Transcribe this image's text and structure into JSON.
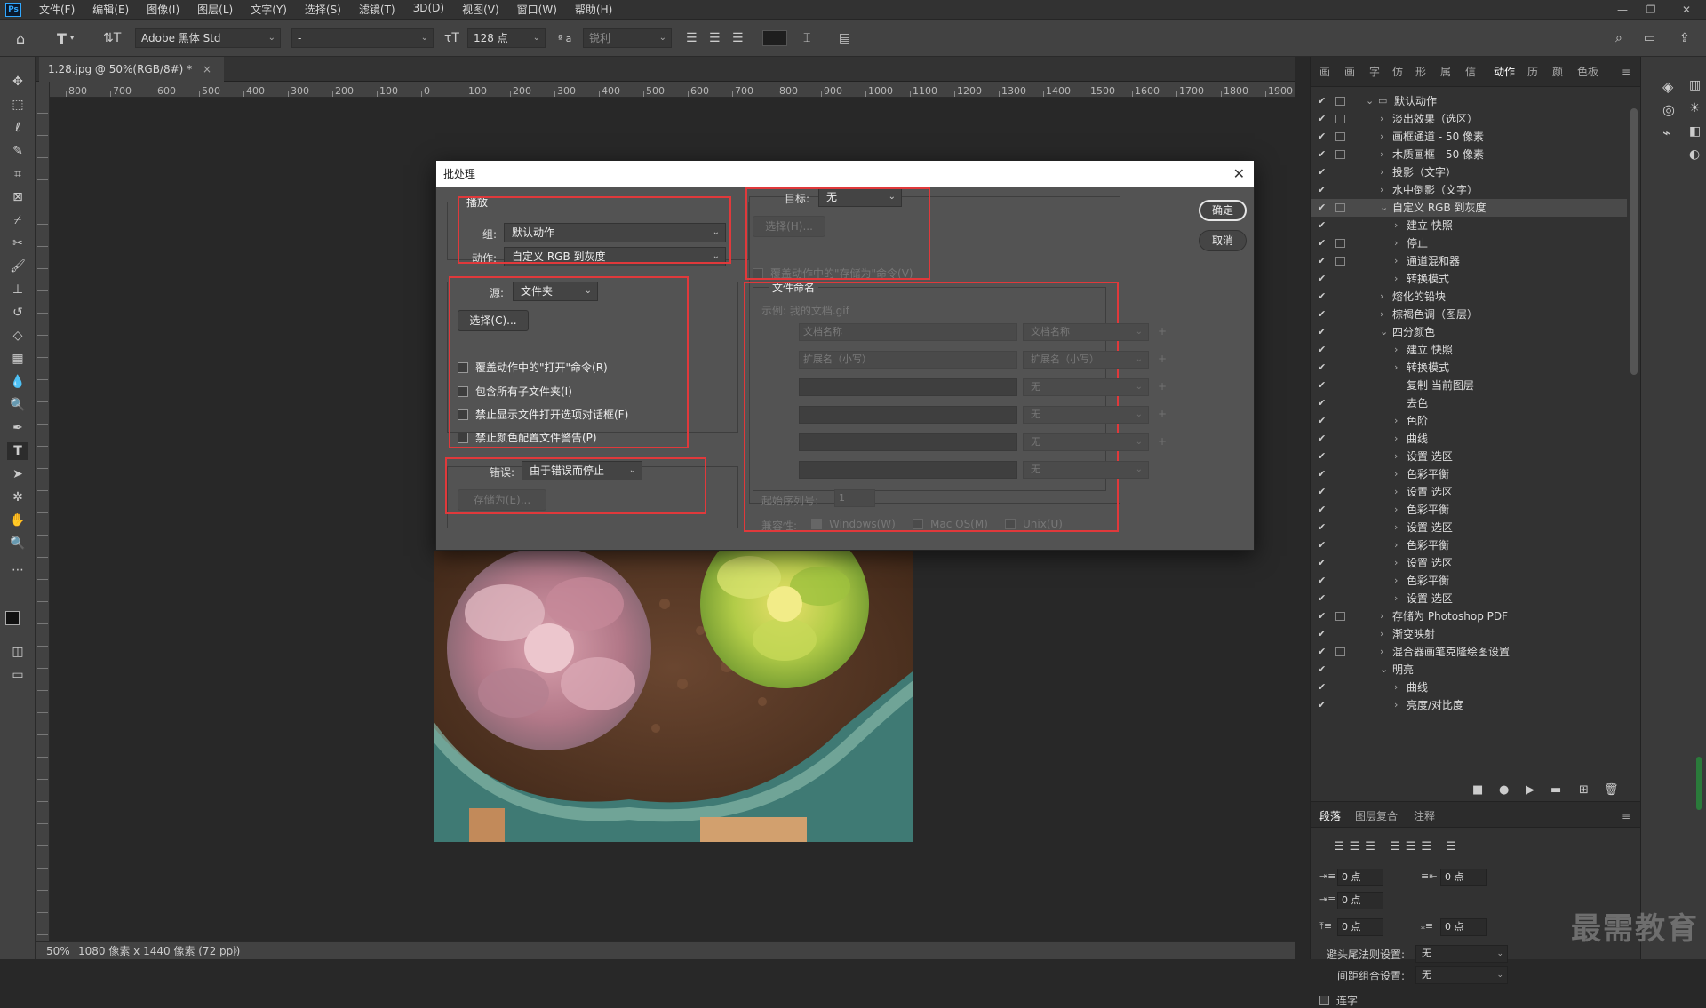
{
  "app": {
    "logo": "Ps"
  },
  "menu": [
    "文件(F)",
    "编辑(E)",
    "图像(I)",
    "图层(L)",
    "文字(Y)",
    "选择(S)",
    "滤镜(T)",
    "3D(D)",
    "视图(V)",
    "窗口(W)",
    "帮助(H)"
  ],
  "window_controls": {
    "minimize": "—",
    "restore": "❐",
    "close": "✕"
  },
  "options": {
    "font_family": "Adobe 黑体 Std",
    "font_style": "-",
    "font_size": "128 点",
    "aa_label": "ª a",
    "aa_mode": "锐利"
  },
  "document": {
    "tab_title": "1.28.jpg @ 50%(RGB/8#) *",
    "tab_close": "×"
  },
  "ruler_top": [
    "800",
    "700",
    "600",
    "500",
    "400",
    "300",
    "200",
    "100",
    "0",
    "100",
    "200",
    "300",
    "400",
    "500",
    "600",
    "700",
    "800",
    "900",
    "1000",
    "1100",
    "1200",
    "1300",
    "1400",
    "1500",
    "1600",
    "1700",
    "1800",
    "1900"
  ],
  "status": {
    "zoom": "50%",
    "info": "1080 像素 x 1440 像素 (72 ppi)",
    "arrow": "〉"
  },
  "dialog": {
    "title": "批处理",
    "close": "✕",
    "play": {
      "label": "播放",
      "group_label": "组:",
      "group_value": "默认动作",
      "action_label": "动作:",
      "action_value": "自定义 RGB 到灰度"
    },
    "source": {
      "label": "源:",
      "value": "文件夹",
      "choose_button": "选择(C)...",
      "checkboxes": [
        "覆盖动作中的\"打开\"命令(R)",
        "包含所有子文件夹(I)",
        "禁止显示文件打开选项对话框(F)",
        "禁止颜色配置文件警告(P)"
      ]
    },
    "error": {
      "label": "错误:",
      "value": "由于错误而停止",
      "save_as_button": "存储为(E)..."
    },
    "target": {
      "label": "目标:",
      "value": "无",
      "choose_button": "选择(H)...",
      "override_checkbox": "覆盖动作中的\"存储为\"命令(V)"
    },
    "naming": {
      "label": "文件命名",
      "example": "示例: 我的文档.gif",
      "rows": [
        {
          "input": "文档名称",
          "select": "文档名称"
        },
        {
          "input": "扩展名（小写）",
          "select": "扩展名（小写）"
        },
        {
          "input": "",
          "select": "无"
        },
        {
          "input": "",
          "select": "无"
        },
        {
          "input": "",
          "select": "无"
        },
        {
          "input": "",
          "select": "无"
        }
      ],
      "plus": "+",
      "serial_label": "起始序列号:",
      "serial_value": "1",
      "compat_label": "兼容性:",
      "compat": [
        "Windows(W)",
        "Mac OS(M)",
        "Unix(U)"
      ]
    },
    "ok_button": "确定",
    "cancel_button": "取消"
  },
  "panel_tabs": [
    "画",
    "画",
    "字",
    "仿",
    "形",
    "属",
    "信",
    "动作",
    "历",
    "颜",
    "色板"
  ],
  "actions": [
    {
      "indent": 0,
      "open": true,
      "folder": true,
      "box": true,
      "label": "默认动作"
    },
    {
      "indent": 1,
      "open": false,
      "box": true,
      "label": "淡出效果（选区）"
    },
    {
      "indent": 1,
      "open": false,
      "box": true,
      "label": "画框通道 - 50 像素"
    },
    {
      "indent": 1,
      "open": false,
      "box": true,
      "label": "木质画框 - 50 像素"
    },
    {
      "indent": 1,
      "open": false,
      "box": false,
      "label": "投影（文字）"
    },
    {
      "indent": 1,
      "open": false,
      "box": false,
      "label": "水中倒影（文字）"
    },
    {
      "indent": 1,
      "open": true,
      "box": true,
      "label": "自定义 RGB 到灰度",
      "selected": true
    },
    {
      "indent": 2,
      "open": false,
      "box": false,
      "label": "建立 快照"
    },
    {
      "indent": 2,
      "open": false,
      "box": true,
      "label": "停止"
    },
    {
      "indent": 2,
      "open": false,
      "box": true,
      "label": "通道混和器"
    },
    {
      "indent": 2,
      "open": false,
      "box": false,
      "label": "转换模式"
    },
    {
      "indent": 1,
      "open": false,
      "box": false,
      "label": "熔化的铅块"
    },
    {
      "indent": 1,
      "open": false,
      "box": false,
      "label": "棕褐色调（图层）"
    },
    {
      "indent": 1,
      "open": true,
      "box": false,
      "label": "四分颜色"
    },
    {
      "indent": 2,
      "open": false,
      "box": false,
      "label": "建立 快照"
    },
    {
      "indent": 2,
      "open": false,
      "box": false,
      "label": "转换模式"
    },
    {
      "indent": 2,
      "open": null,
      "box": false,
      "label": "复制 当前图层"
    },
    {
      "indent": 2,
      "open": null,
      "box": false,
      "label": "去色"
    },
    {
      "indent": 2,
      "open": false,
      "box": false,
      "label": "色阶"
    },
    {
      "indent": 2,
      "open": false,
      "box": false,
      "label": "曲线"
    },
    {
      "indent": 2,
      "open": false,
      "box": false,
      "label": "设置 选区"
    },
    {
      "indent": 2,
      "open": false,
      "box": false,
      "label": "色彩平衡"
    },
    {
      "indent": 2,
      "open": false,
      "box": false,
      "label": "设置 选区"
    },
    {
      "indent": 2,
      "open": false,
      "box": false,
      "label": "色彩平衡"
    },
    {
      "indent": 2,
      "open": false,
      "box": false,
      "label": "设置 选区"
    },
    {
      "indent": 2,
      "open": false,
      "box": false,
      "label": "色彩平衡"
    },
    {
      "indent": 2,
      "open": false,
      "box": false,
      "label": "设置 选区"
    },
    {
      "indent": 2,
      "open": false,
      "box": false,
      "label": "色彩平衡"
    },
    {
      "indent": 2,
      "open": false,
      "box": false,
      "label": "设置 选区"
    },
    {
      "indent": 1,
      "open": false,
      "box": true,
      "label": "存储为 Photoshop PDF"
    },
    {
      "indent": 1,
      "open": false,
      "box": false,
      "label": "渐变映射"
    },
    {
      "indent": 1,
      "open": false,
      "box": true,
      "label": "混合器画笔克隆绘图设置"
    },
    {
      "indent": 1,
      "open": true,
      "box": false,
      "label": "明亮"
    },
    {
      "indent": 2,
      "open": false,
      "box": false,
      "label": "曲线"
    },
    {
      "indent": 2,
      "open": false,
      "box": false,
      "label": "亮度/对比度"
    }
  ],
  "action_buttons": [
    "■",
    "●",
    "▶",
    "▬",
    "⊞",
    "🗑"
  ],
  "para_tabs": [
    "段落",
    "图层复合",
    "注释"
  ],
  "paragraph": {
    "left_indent": "0 点",
    "right_indent": "0 点",
    "first_indent": "0 点",
    "space_before": "0 点",
    "space_after": "0 点",
    "kinsoku_label": "避头尾法则设置:",
    "kinsoku_value": "无",
    "mojikumi_label": "间距组合设置:",
    "mojikumi_value": "无",
    "hyphen_label": "连字"
  },
  "watermark": "最需教育",
  "colors": {
    "highlight": "#e0393b",
    "accent": "#31a8ff"
  }
}
